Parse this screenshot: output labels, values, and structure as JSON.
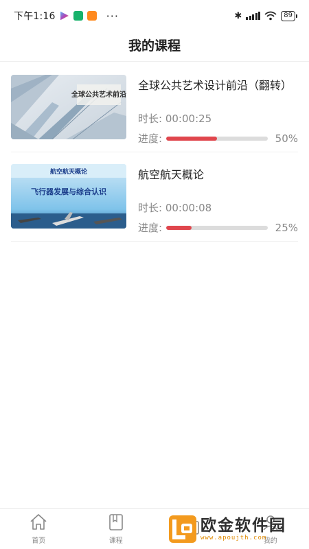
{
  "status_bar": {
    "time": "下午1:16",
    "dots": "···",
    "bluetooth": "✱",
    "battery": "89",
    "icons": [
      "play-store-icon",
      "shield-icon",
      "app-icon",
      "bluetooth-icon",
      "signal-icon",
      "wifi-icon",
      "battery-icon"
    ]
  },
  "header": {
    "title": "我的课程"
  },
  "courses": [
    {
      "title": "全球公共艺术设计前沿（翻转）",
      "thumb_text": "全球公共艺术前沿",
      "duration_label": "时长:",
      "duration": "00:00:25",
      "progress_label": "进度:",
      "progress_percent": 50,
      "progress_text": "50%"
    },
    {
      "title": "航空航天概论",
      "thumb_title": "航空航天概论",
      "thumb_subtitle": "飞行器发展与综合认识",
      "duration_label": "时长:",
      "duration": "00:00:08",
      "progress_label": "进度:",
      "progress_percent": 25,
      "progress_text": "25%"
    }
  ],
  "bottom_nav": {
    "items": [
      {
        "label": "首页",
        "icon": "home-icon"
      },
      {
        "label": "课程",
        "icon": "book-icon"
      },
      {
        "label": "",
        "icon": "study-icon"
      },
      {
        "label": "我的",
        "icon": "user-icon"
      }
    ]
  },
  "watermark": {
    "main": "欧金软件园",
    "sub": "www.apoujth.com"
  },
  "colors": {
    "accent": "#e0464d",
    "track": "#dcdcdc",
    "text_secondary": "#888888"
  }
}
